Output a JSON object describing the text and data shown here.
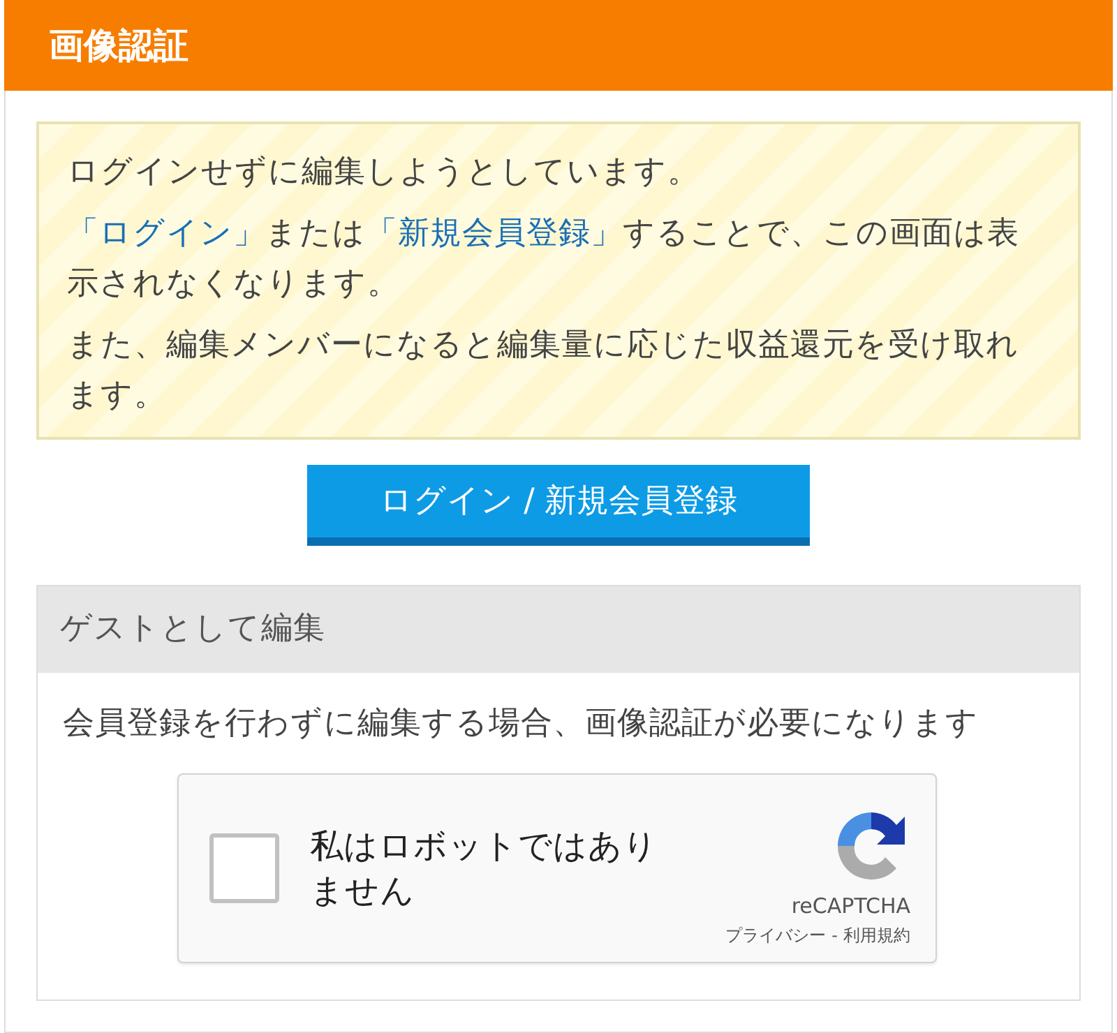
{
  "header": {
    "title": "画像認証"
  },
  "notice": {
    "paragraphs": [
      [
        {
          "text": "ログインせずに編集しようとしています。",
          "link": false
        }
      ],
      [
        {
          "text": "「ログイン」",
          "link": true
        },
        {
          "text": "または",
          "link": false
        },
        {
          "text": "「新規会員登録」",
          "link": true
        },
        {
          "text": "することで、この画面は表示されなくなります。",
          "link": false
        }
      ],
      [
        {
          "text": "また、編集メンバーになると編集量に応じた収益還元を受け取れます。",
          "link": false
        }
      ]
    ]
  },
  "login_button": {
    "label": "ログイン / 新規会員登録"
  },
  "guest": {
    "title": "ゲストとして編集",
    "description": "会員登録を行わずに編集する場合、画像認証が必要になります",
    "captcha": {
      "label": "私はロボットではありません",
      "checked": false,
      "brand": "reCAPTCHA",
      "privacy": "プライバシー",
      "separator": "-",
      "terms": "利用規約"
    }
  }
}
